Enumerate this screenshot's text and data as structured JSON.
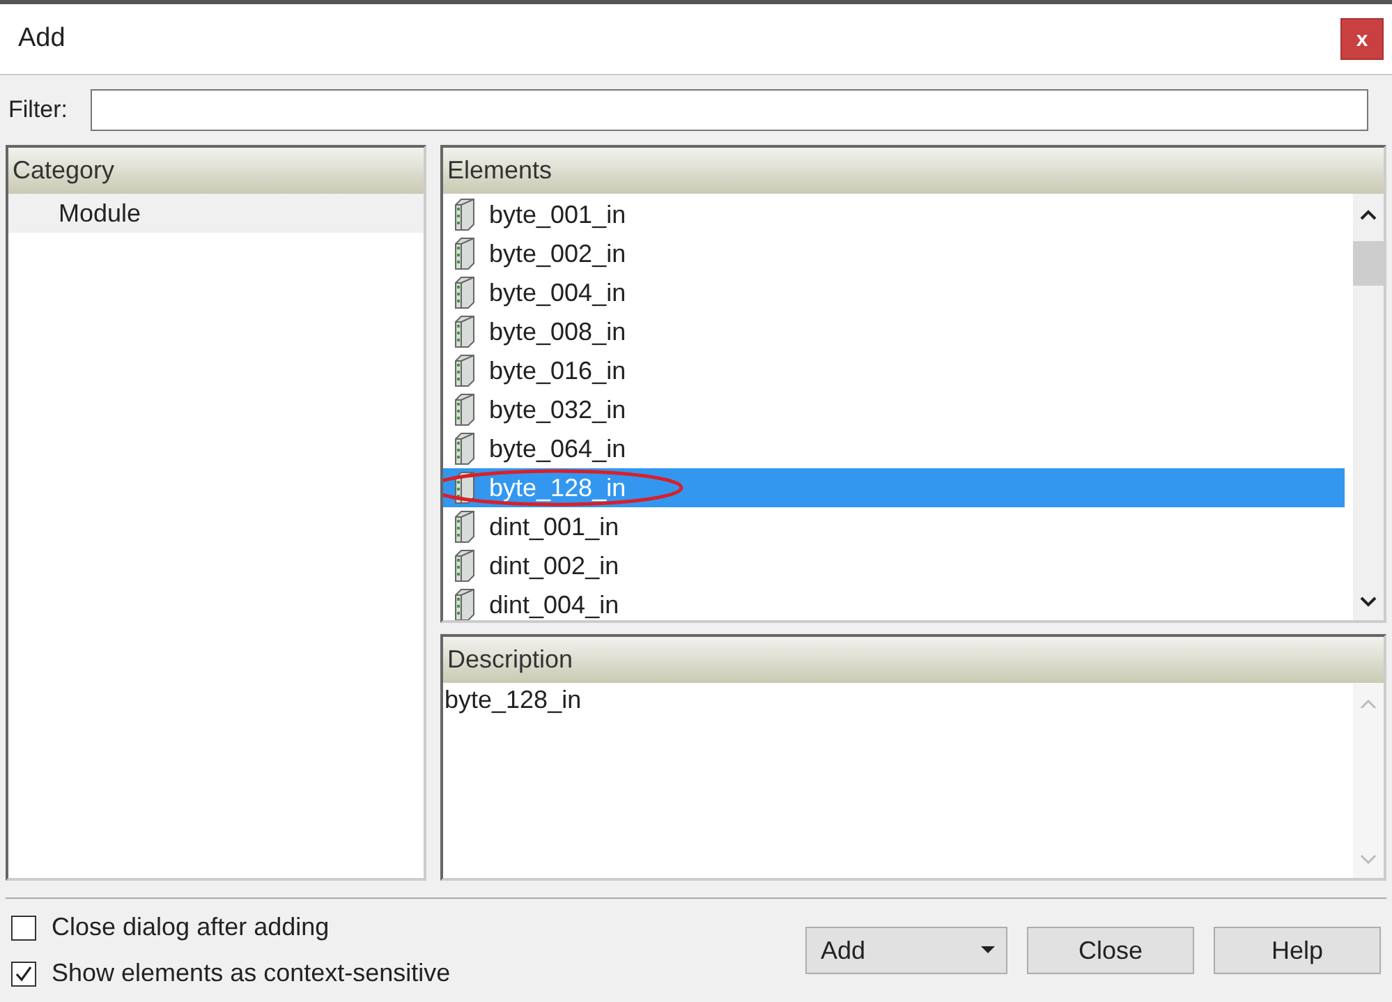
{
  "window": {
    "title": "Add",
    "close_label": "x"
  },
  "filter": {
    "label": "Filter:"
  },
  "category": {
    "header": "Category",
    "items": [
      {
        "label": "Module",
        "selected": true
      }
    ]
  },
  "elements": {
    "header": "Elements",
    "items": [
      {
        "label": "byte_001_in",
        "selected": false,
        "circled": false
      },
      {
        "label": "byte_002_in",
        "selected": false,
        "circled": false
      },
      {
        "label": "byte_004_in",
        "selected": false,
        "circled": false
      },
      {
        "label": "byte_008_in",
        "selected": false,
        "circled": false
      },
      {
        "label": "byte_016_in",
        "selected": false,
        "circled": false
      },
      {
        "label": "byte_032_in",
        "selected": false,
        "circled": false
      },
      {
        "label": "byte_064_in",
        "selected": false,
        "circled": false
      },
      {
        "label": "byte_128_in",
        "selected": true,
        "circled": true
      },
      {
        "label": "dint_001_in",
        "selected": false,
        "circled": false
      },
      {
        "label": "dint_002_in",
        "selected": false,
        "circled": false
      },
      {
        "label": "dint_004_in",
        "selected": false,
        "circled": false
      }
    ]
  },
  "description": {
    "header": "Description",
    "text": "byte_128_in"
  },
  "options": [
    {
      "label": "Close dialog after adding",
      "checked": false
    },
    {
      "label": "Show elements as context-sensitive",
      "checked": true
    }
  ],
  "buttons": [
    {
      "label": "Add",
      "kind": "dropdown"
    },
    {
      "label": "Close",
      "kind": "plain"
    },
    {
      "label": "Help",
      "kind": "plain"
    }
  ]
}
